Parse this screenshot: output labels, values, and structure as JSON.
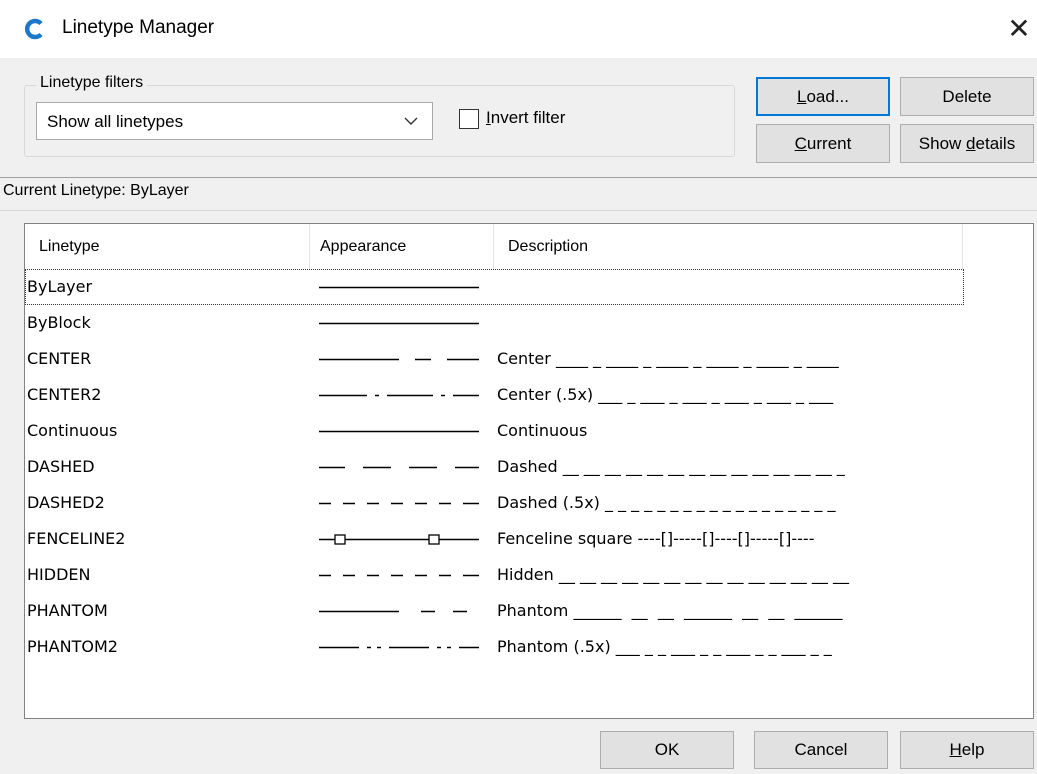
{
  "window": {
    "title": "Linetype Manager",
    "app_icon": "autocad-c-icon",
    "close_glyph": "✕"
  },
  "filters": {
    "legend": "Linetype filters",
    "selected": "Show all linetypes",
    "invert_checked": false,
    "invert_label_accel": "I",
    "invert_label_rest": "nvert filter"
  },
  "buttons": {
    "load_accel": "L",
    "load_rest": "oad...",
    "delete": "Delete",
    "current_accel": "C",
    "current_rest": "urrent",
    "details_pre": "Show ",
    "details_accel": "d",
    "details_rest": "etails",
    "ok": "OK",
    "cancel": "Cancel",
    "help_accel": "H",
    "help_rest": "elp"
  },
  "current_linetype": "Current Linetype:  ByLayer",
  "list": {
    "columns": [
      "Linetype",
      "Appearance",
      "Description"
    ],
    "rows": [
      {
        "name": "ByLayer",
        "pattern": "solid",
        "description": ""
      },
      {
        "name": "ByBlock",
        "pattern": "solid",
        "description": ""
      },
      {
        "name": "CENTER",
        "pattern": "center",
        "description": "Center ____ _ ____ _ ____ _ ____ _ ____ _ ____"
      },
      {
        "name": "CENTER2",
        "pattern": "center2",
        "description": "Center (.5x) ___ _ ___ _ ___ _ ___ _ ___ _ ___"
      },
      {
        "name": "Continuous",
        "pattern": "solid",
        "description": "Continuous"
      },
      {
        "name": "DASHED",
        "pattern": "dashed",
        "description": "Dashed __ __ __ __ __ __ __ __ __ __ __ __ __ _"
      },
      {
        "name": "DASHED2",
        "pattern": "dashed2",
        "description": "Dashed (.5x) _ _ _ _ _ _ _ _ _ _ _ _ _ _ _ _ _ _"
      },
      {
        "name": "FENCELINE2",
        "pattern": "fenceline",
        "description": "Fenceline square ----[]-----[]----[]-----[]----"
      },
      {
        "name": "HIDDEN",
        "pattern": "dashed2",
        "description": "Hidden __ __ __ __ __ __ __ __ __ __ __ __ __ __"
      },
      {
        "name": "PHANTOM",
        "pattern": "phantom",
        "description": "Phantom ______  __  __  ______  __  __  ______"
      },
      {
        "name": "PHANTOM2",
        "pattern": "phantom2",
        "description": "Phantom (.5x) ___ _ _ ___ _ _ ___ _ _ ___ _ _"
      }
    ]
  }
}
